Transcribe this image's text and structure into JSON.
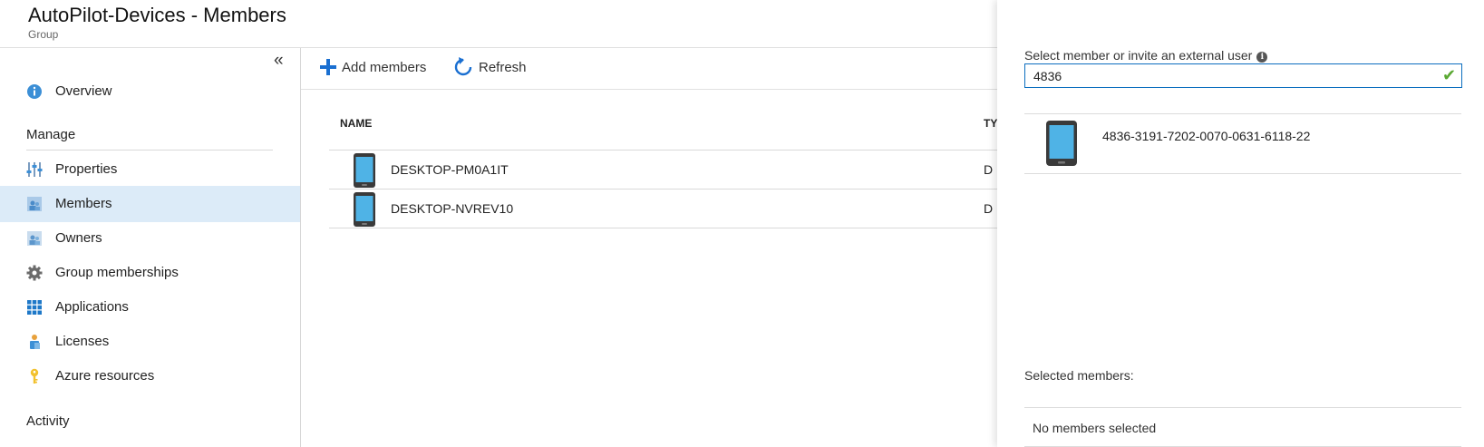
{
  "header": {
    "title": "AutoPilot-Devices - Members",
    "subtitle": "Group"
  },
  "sidebar": {
    "collapse_glyph": "«",
    "items": [
      {
        "label": "Overview",
        "icon": "info-icon"
      },
      {
        "label": "Properties",
        "icon": "properties-icon"
      },
      {
        "label": "Members",
        "icon": "members-icon",
        "active": true
      },
      {
        "label": "Owners",
        "icon": "owners-icon"
      },
      {
        "label": "Group memberships",
        "icon": "gear-icon"
      },
      {
        "label": "Applications",
        "icon": "applications-grid-icon"
      },
      {
        "label": "Licenses",
        "icon": "licenses-icon"
      },
      {
        "label": "Azure resources",
        "icon": "key-icon"
      }
    ],
    "sections": {
      "manage": "Manage",
      "activity": "Activity"
    }
  },
  "toolbar": {
    "add_label": "Add members",
    "refresh_label": "Refresh"
  },
  "table": {
    "headers": {
      "name": "NAME",
      "type": "TY"
    },
    "rows": [
      {
        "name": "DESKTOP-PM0A1IT",
        "type": "D",
        "icon": "device-icon"
      },
      {
        "name": "DESKTOP-NVREV10",
        "type": "D",
        "icon": "device-icon"
      }
    ]
  },
  "panel": {
    "label": "Select member or invite an external user",
    "search_value": "4836",
    "results": [
      {
        "name": "4836-3191-7202-0070-0631-6118-22",
        "icon": "device-icon"
      }
    ],
    "selected_label": "Selected members:",
    "selected_empty": "No members selected"
  },
  "colors": {
    "accent": "#0b6ebf",
    "active_nav": "#dcebf8",
    "valid_check": "#5aa832",
    "device_screen": "#4fb3e6"
  }
}
